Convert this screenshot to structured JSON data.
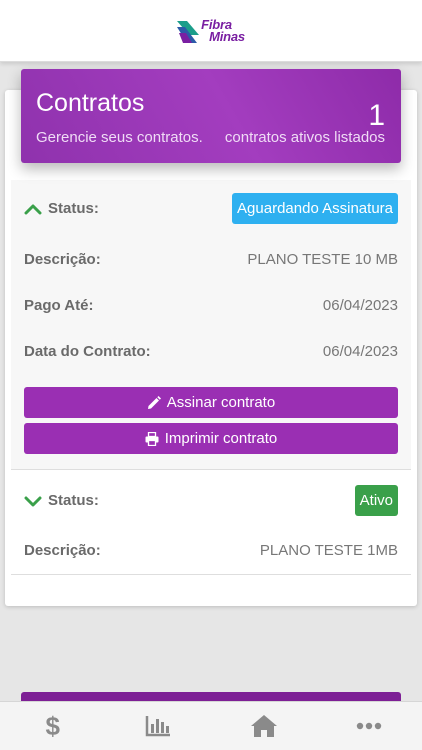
{
  "header": {
    "logo": {
      "line1": "Fibra",
      "line2": "Minas"
    }
  },
  "hero": {
    "title": "Contratos",
    "subtitle": "Gerencie seus contratos.",
    "count": "1",
    "count_label": "contratos ativos listados"
  },
  "contracts": [
    {
      "expanded": true,
      "status_label": "Status:",
      "status": "Aguardando Assinatura",
      "status_color": "#2eb0f0",
      "fields": [
        {
          "label": "Descrição:",
          "value": "PLANO TESTE 10 MB"
        },
        {
          "label": "Pago Até:",
          "value": "06/04/2023"
        },
        {
          "label": "Data do Contrato:",
          "value": "06/04/2023"
        }
      ],
      "actions": [
        {
          "label": "Assinar contrato",
          "icon": "pencil-icon"
        },
        {
          "label": "Imprimir contrato",
          "icon": "printer-icon"
        }
      ]
    },
    {
      "expanded": false,
      "status_label": "Status:",
      "status": "Ativo",
      "status_color": "#3aa04a",
      "fields": [
        {
          "label": "Descrição:",
          "value": "PLANO TESTE 1MB"
        }
      ]
    }
  ],
  "tab_bar": {
    "tabs": [
      {
        "icon": "dollar-icon",
        "glyph": "$"
      },
      {
        "icon": "bar-chart-icon"
      },
      {
        "icon": "home-icon"
      },
      {
        "icon": "more-icon"
      }
    ]
  },
  "colors": {
    "accent": "#9a2fb3",
    "chevron": "#3aa04a"
  }
}
